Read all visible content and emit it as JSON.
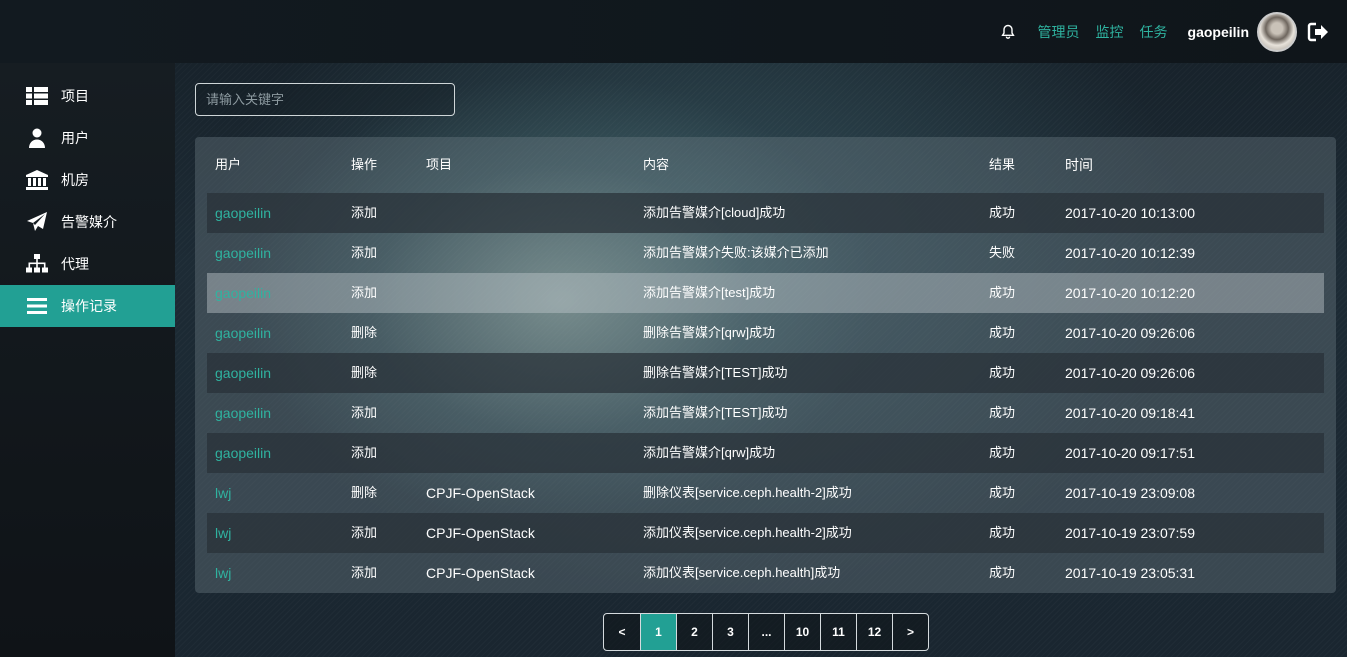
{
  "topbar": {
    "links": [
      "管理员",
      "监控",
      "任务"
    ],
    "username": "gaopeilin",
    "icons": [
      "bell-icon",
      "logout-icon"
    ]
  },
  "sidebar": {
    "items": [
      {
        "label": "项目",
        "icon": "grid-list-icon",
        "active": false
      },
      {
        "label": "用户",
        "icon": "user-icon",
        "active": false
      },
      {
        "label": "机房",
        "icon": "bank-icon",
        "active": false
      },
      {
        "label": "告警媒介",
        "icon": "paper-plane-icon",
        "active": false
      },
      {
        "label": "代理",
        "icon": "sitemap-icon",
        "active": false
      },
      {
        "label": "操作记录",
        "icon": "menu-bars-icon",
        "active": true
      }
    ]
  },
  "search": {
    "placeholder": "请输入关键字",
    "value": ""
  },
  "table": {
    "headers": [
      "用户",
      "操作",
      "项目",
      "内容",
      "结果",
      "时间"
    ],
    "rows": [
      {
        "user": "gaopeilin",
        "op": "添加",
        "proj": "",
        "content": "添加告警媒介[cloud]成功",
        "result": "成功",
        "time": "2017-10-20 10:13:00"
      },
      {
        "user": "gaopeilin",
        "op": "添加",
        "proj": "",
        "content": "添加告警媒介失败:该媒介已添加",
        "result": "失败",
        "time": "2017-10-20 10:12:39"
      },
      {
        "user": "gaopeilin",
        "op": "添加",
        "proj": "",
        "content": "添加告警媒介[test]成功",
        "result": "成功",
        "time": "2017-10-20 10:12:20"
      },
      {
        "user": "gaopeilin",
        "op": "删除",
        "proj": "",
        "content": "删除告警媒介[qrw]成功",
        "result": "成功",
        "time": "2017-10-20 09:26:06"
      },
      {
        "user": "gaopeilin",
        "op": "删除",
        "proj": "",
        "content": "删除告警媒介[TEST]成功",
        "result": "成功",
        "time": "2017-10-20 09:26:06"
      },
      {
        "user": "gaopeilin",
        "op": "添加",
        "proj": "",
        "content": "添加告警媒介[TEST]成功",
        "result": "成功",
        "time": "2017-10-20 09:18:41"
      },
      {
        "user": "gaopeilin",
        "op": "添加",
        "proj": "",
        "content": "添加告警媒介[qrw]成功",
        "result": "成功",
        "time": "2017-10-20 09:17:51"
      },
      {
        "user": "lwj",
        "op": "删除",
        "proj": "CPJF-OpenStack",
        "content": "删除仪表[service.ceph.health-2]成功",
        "result": "成功",
        "time": "2017-10-19 23:09:08"
      },
      {
        "user": "lwj",
        "op": "添加",
        "proj": "CPJF-OpenStack",
        "content": "添加仪表[service.ceph.health-2]成功",
        "result": "成功",
        "time": "2017-10-19 23:07:59"
      },
      {
        "user": "lwj",
        "op": "添加",
        "proj": "CPJF-OpenStack",
        "content": "添加仪表[service.ceph.health]成功",
        "result": "成功",
        "time": "2017-10-19 23:05:31"
      }
    ]
  },
  "pagination": {
    "items": [
      "<",
      "1",
      "2",
      "3",
      "...",
      "10",
      "11",
      "12",
      ">"
    ],
    "current": "1"
  },
  "colors": {
    "accent": "#22a094",
    "link": "#2fb3a0"
  }
}
